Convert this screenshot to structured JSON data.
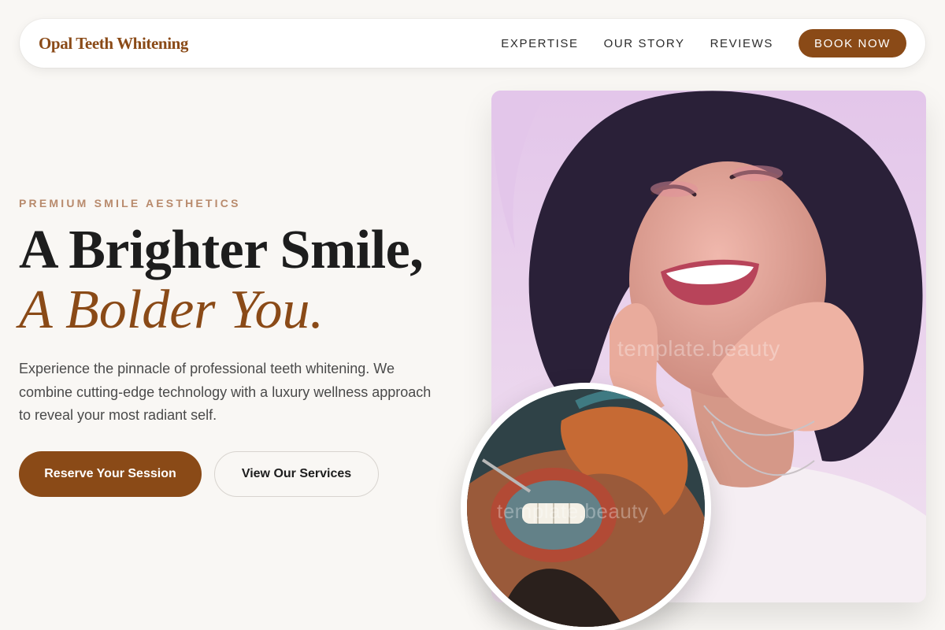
{
  "nav": {
    "brand": "Opal Teeth Whitening",
    "links": [
      "EXPERTISE",
      "OUR STORY",
      "REVIEWS"
    ],
    "cta": "BOOK NOW"
  },
  "hero": {
    "eyebrow": "PREMIUM SMILE AESTHETICS",
    "title_line1": "A Brighter Smile,",
    "title_line2": "A Bolder You.",
    "description": "Experience the pinnacle of professional teeth whitening. We combine cutting-edge technology with a luxury wellness approach to reveal your most radiant self.",
    "primary_button": "Reserve Your Session",
    "secondary_button": "View Our Services"
  },
  "images": {
    "main_watermark": "template.beauty",
    "inset_watermark": "template.beauty",
    "main_icon": "smiling-woman-photo",
    "inset_icon": "dental-whitening-treatment-photo"
  },
  "colors": {
    "accent": "#8a4a17",
    "eyebrow": "#b88a6c",
    "background": "#f9f7f4"
  }
}
